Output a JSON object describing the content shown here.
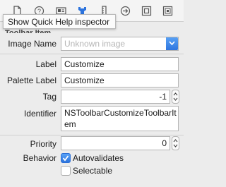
{
  "toolbar": {
    "tooltip": "Show Quick Help inspector",
    "icons": [
      "file-inspector",
      "quick-help-inspector",
      "identity-inspector",
      "attributes-inspector",
      "size-inspector",
      "connections-inspector",
      "bindings-inspector",
      "view-effects-inspector"
    ],
    "active_index": 3,
    "accent": "#2c73dd"
  },
  "section": {
    "title": "Toolbar Item"
  },
  "fields": {
    "image_name": {
      "label": "Image Name",
      "placeholder": "Unknown image"
    },
    "label": {
      "label": "Label",
      "value": "Customize"
    },
    "palette_label": {
      "label": "Palette Label",
      "value": "Customize"
    },
    "tag": {
      "label": "Tag",
      "value": "-1"
    },
    "identifier": {
      "label": "Identifier",
      "line1": "NSToolbarCustomizeToolbarIt",
      "line2": "em"
    },
    "priority": {
      "label": "Priority",
      "value": "0"
    }
  },
  "behavior": {
    "label": "Behavior",
    "autovalidates": {
      "label": "Autovalidates",
      "checked": true
    },
    "selectable": {
      "label": "Selectable",
      "checked": false
    }
  }
}
